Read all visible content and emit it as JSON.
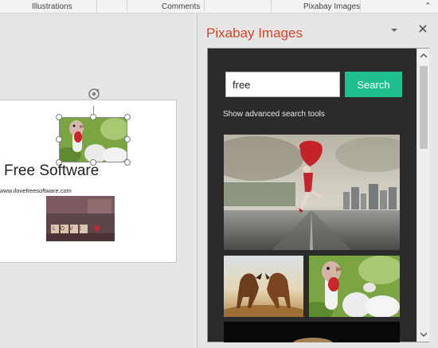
{
  "ribbon": {
    "groups": [
      "Illustrations",
      "Comments",
      "Pixabay Images"
    ]
  },
  "slide": {
    "title": "Free Software",
    "url": "www.ilovefreesoftware.com",
    "love_blocks_text": "LOVE"
  },
  "pane": {
    "title": "Pixabay Images",
    "search": {
      "value": "free",
      "button_label": "Search"
    },
    "advanced_link": "Show advanced search tools",
    "results": [
      "dancer",
      "horses",
      "turkey",
      "dark"
    ]
  },
  "colors": {
    "pane_title": "#d24726",
    "search_button": "#1fbf8f",
    "pane_bg": "#2b2b2b"
  },
  "icons": {
    "dropdown": "chevron-down-icon",
    "close": "close-icon",
    "rotate": "rotate-handle-icon"
  }
}
